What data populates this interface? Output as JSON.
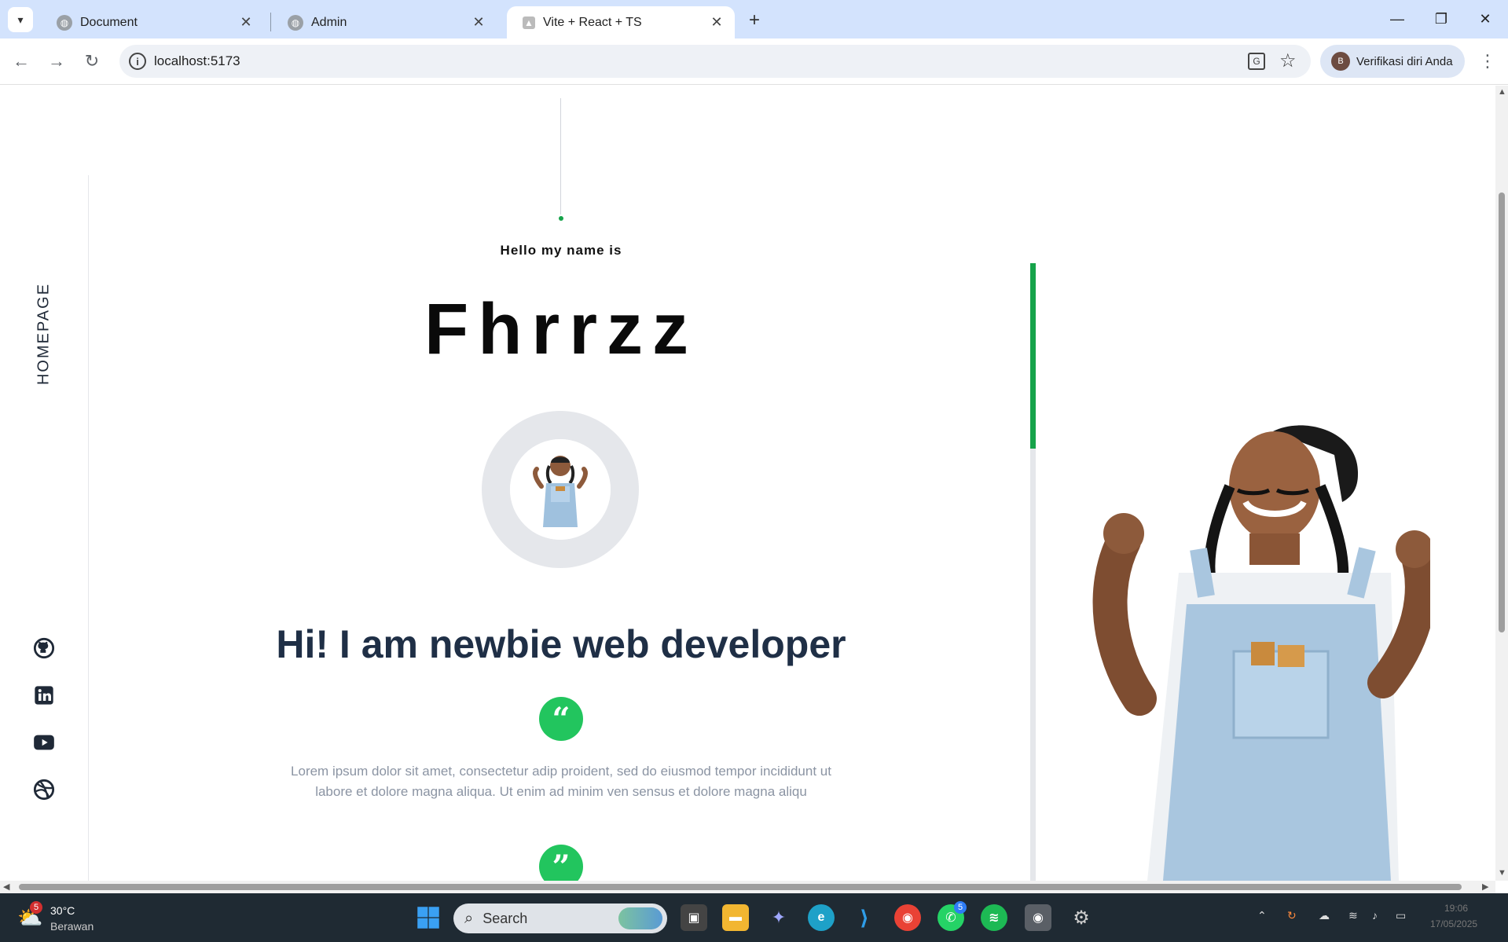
{
  "browser": {
    "tabs": [
      {
        "title": "Document",
        "active": false
      },
      {
        "title": "Admin",
        "active": false
      },
      {
        "title": "Vite + React + TS",
        "active": true
      }
    ],
    "url": "localhost:5173",
    "profile_label": "Verifikasi diri Anda",
    "profile_initial": "B"
  },
  "sidebar": {
    "vertical_label": "HOMEPAGE",
    "social_icons": [
      "github-icon",
      "linkedin-icon",
      "youtube-icon",
      "dribbble-icon"
    ]
  },
  "hero": {
    "greeting": "Hello my name is",
    "name": "Fhrrzz",
    "headline": "Hi! I am newbie web developer",
    "open_quote": "“",
    "close_quote": "”",
    "description": "Lorem ipsum dolor sit amet, consectetur adip proident, sed do eiusmod tempor incididunt ut labore et dolore magna aliqua. Ut enim ad minim ven sensus et dolore magna aliqu",
    "scroll_progress": 0.3
  },
  "colors": {
    "accent": "#22c55e",
    "accent_dark": "#16a34a",
    "headline": "#1f2f46",
    "body_text": "#8b94a3"
  },
  "taskbar": {
    "weather_temp": "30°C",
    "weather_desc": "Berawan",
    "weather_badge": "5",
    "search_placeholder": "Search",
    "whatsapp_badge": "5",
    "clock_time": "19:06",
    "clock_date": "17/05/2025"
  }
}
